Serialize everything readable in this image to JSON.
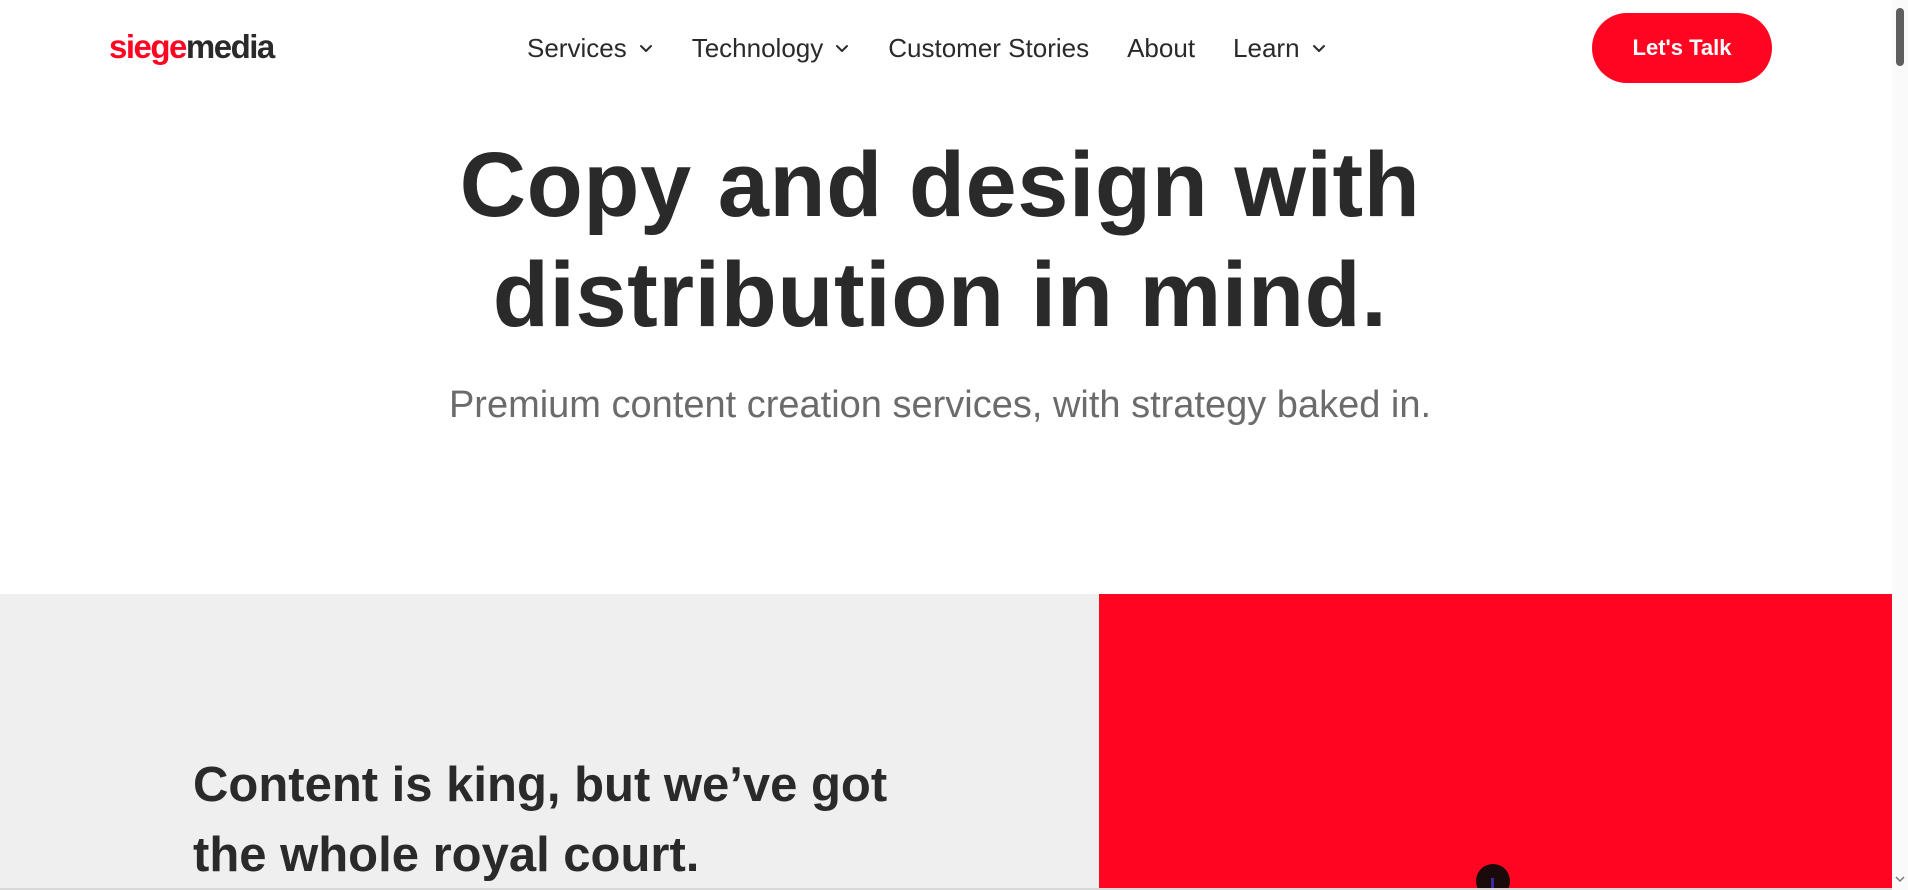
{
  "brand": {
    "logo_part1": "siege",
    "logo_part2": "media",
    "accent_color": "#ff0522",
    "text_color": "#2a2a2a"
  },
  "nav": {
    "items": [
      {
        "label": "Services",
        "has_dropdown": true
      },
      {
        "label": "Technology",
        "has_dropdown": true
      },
      {
        "label": "Customer Stories",
        "has_dropdown": false
      },
      {
        "label": "About",
        "has_dropdown": false
      },
      {
        "label": "Learn",
        "has_dropdown": true
      }
    ],
    "cta_label": "Let's Talk"
  },
  "hero": {
    "title_line1": "Copy and design with",
    "title_line2": "distribution in mind.",
    "subtitle": "Premium content creation services, with strategy baked in."
  },
  "section": {
    "title_line1": "Content is king, but we’ve got",
    "title_line2": "the whole royal court.",
    "left_bg": "#efefef",
    "right_bg": "#ff0522"
  },
  "icons": {
    "dropdown": "chevron-down-icon",
    "scroll": "scroll-down-arrow-icon"
  }
}
